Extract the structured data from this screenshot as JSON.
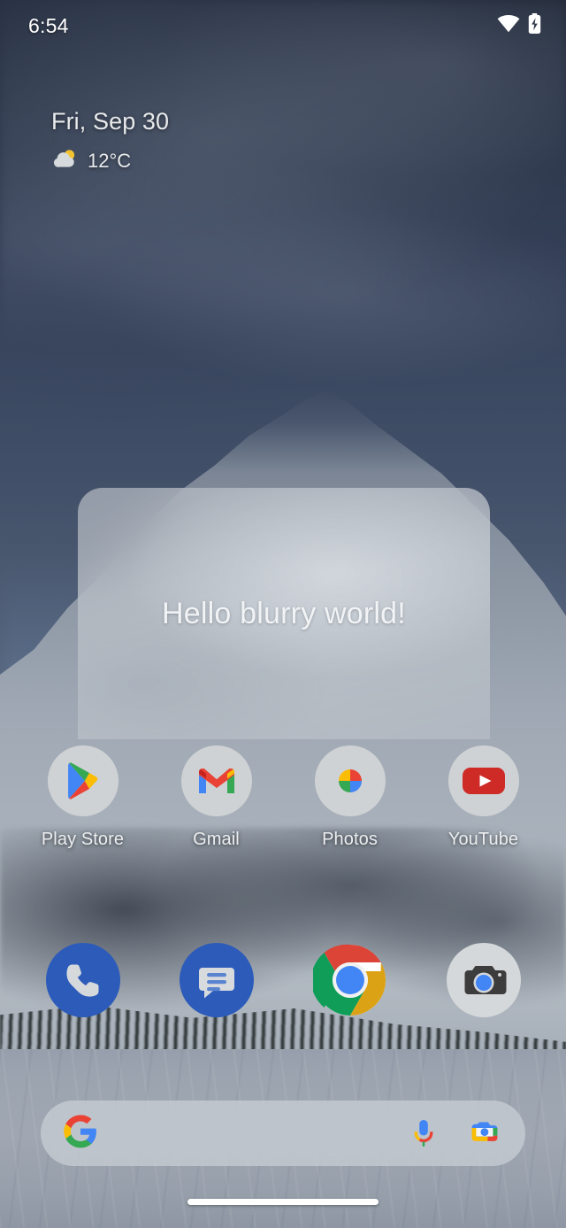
{
  "status_bar": {
    "time": "6:54",
    "icons": [
      {
        "name": "wifi-icon",
        "label": "Wi-Fi connected"
      },
      {
        "name": "battery-charging-icon",
        "label": "Battery charging"
      }
    ]
  },
  "date_widget": {
    "date": "Fri, Sep 30",
    "weather_icon": "partly-cloudy-icon",
    "temperature": "12°C"
  },
  "blur_card": {
    "text": "Hello blurry world!",
    "background_color": "#cdd2d8",
    "text_color": "#f1f3f5",
    "corner_radius_px": 28
  },
  "app_grid": {
    "apps": [
      {
        "label": "Play Store",
        "icon": "play-store-icon"
      },
      {
        "label": "Gmail",
        "icon": "gmail-icon"
      },
      {
        "label": "Photos",
        "icon": "google-photos-icon"
      },
      {
        "label": "YouTube",
        "icon": "youtube-icon"
      }
    ]
  },
  "dock": {
    "apps": [
      {
        "label": "Phone",
        "icon": "phone-icon"
      },
      {
        "label": "Messages",
        "icon": "messages-icon"
      },
      {
        "label": "Chrome",
        "icon": "chrome-icon"
      },
      {
        "label": "Camera",
        "icon": "camera-icon"
      }
    ]
  },
  "search_bar": {
    "placeholder": "",
    "value": "",
    "leading_icon": "google-g-icon",
    "actions": [
      {
        "name": "voice-search-icon",
        "label": "Voice search"
      },
      {
        "name": "google-lens-icon",
        "label": "Google Lens"
      }
    ]
  },
  "navigation": {
    "home_indicator": "home-gesture-bar"
  },
  "colors": {
    "google_blue": "#4285F4",
    "google_red": "#EA4335",
    "google_yellow": "#FBBC04",
    "google_green": "#34A853",
    "youtube_red": "#CE2B27",
    "dock_blue": "#2C5BB9",
    "icon_circle": "#cfd2d4"
  }
}
